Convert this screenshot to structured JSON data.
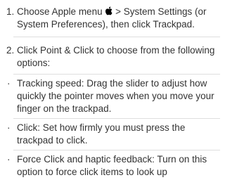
{
  "steps": [
    {
      "number": "1.",
      "text_before_icon": "Choose Apple menu ",
      "icon": "apple-logo-icon",
      "text_after_icon": " > System Settings (or System Preferences), then click Trackpad."
    },
    {
      "number": "2.",
      "text": "Click Point & Click to choose from the following options:"
    }
  ],
  "bullet_marker": "·",
  "bullets": [
    "Tracking speed: Drag the slider to adjust how quickly the pointer moves when you move your finger on the trackpad.",
    "Click: Set how firmly you must press the trackpad to click.",
    "Force Click and haptic feedback: Turn on this option to force click items to look up"
  ],
  "colors": {
    "text": "#333333",
    "divider": "#dedede",
    "background": "#ffffff"
  }
}
